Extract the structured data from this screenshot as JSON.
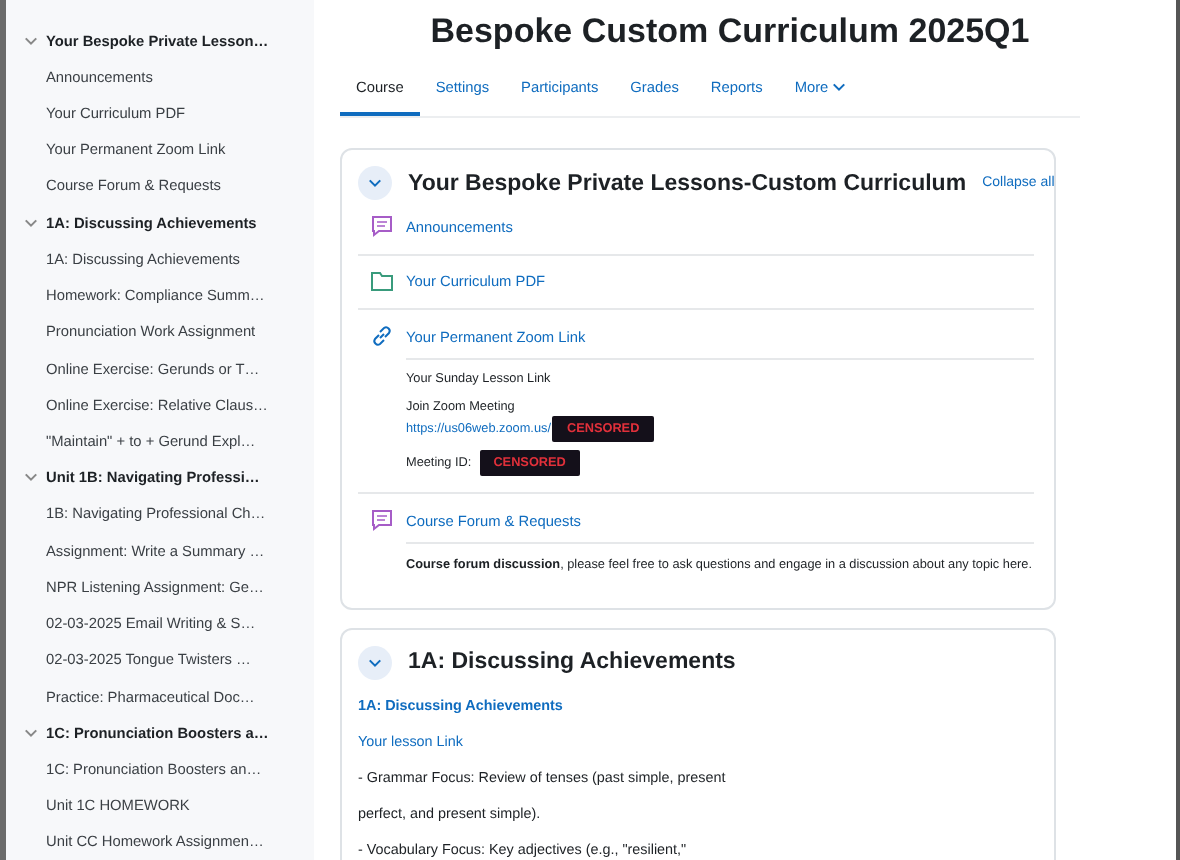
{
  "sidebar": {
    "sections": [
      {
        "title": "Your Bespoke Private Lesson…",
        "expanded": true,
        "items": [
          "Announcements",
          "Your Curriculum PDF",
          "Your Permanent Zoom Link",
          "Course Forum & Requests"
        ]
      },
      {
        "title": "1A: Discussing Achievements",
        "expanded": true,
        "items": [
          "1A: Discussing Achievements",
          "Homework: Compliance Summ…",
          "Pronunciation Work Assignment",
          "Online Exercise: Gerunds or T…",
          "Online Exercise: Relative Claus…",
          "\"Maintain\" + to + Gerund Expl…"
        ]
      },
      {
        "title": "Unit 1B: Navigating Professi…",
        "expanded": true,
        "items": [
          "1B: Navigating Professional Ch…",
          "Assignment: Write a Summary …",
          "NPR Listening Assignment: Ge…",
          "02-03-2025 Email Writing & S…",
          "02-03-2025 Tongue Twisters …",
          "Practice: Pharmaceutical Doc…"
        ]
      },
      {
        "title": "1C: Pronunciation Boosters a…",
        "expanded": true,
        "items": [
          "1C: Pronunciation Boosters an…",
          "Unit 1C HOMEWORK",
          "Unit CC Homework Assignmen…"
        ]
      }
    ]
  },
  "course_title": "Bespoke Custom Curriculum 2025Q1",
  "tabs": [
    {
      "label": "Course",
      "selected": true,
      "kind": "plain"
    },
    {
      "label": "Settings",
      "selected": false,
      "kind": "plain"
    },
    {
      "label": "Participants",
      "selected": false,
      "kind": "plain"
    },
    {
      "label": "Grades",
      "selected": false,
      "kind": "plain"
    },
    {
      "label": "Reports",
      "selected": false,
      "kind": "plain"
    },
    {
      "label": "More",
      "selected": false,
      "kind": "menu"
    }
  ],
  "section_1": {
    "title": "Your Bespoke Private Lessons-Custom Curriculum",
    "expanded": true,
    "collapse_all": "Collapse all",
    "activities": [
      {
        "kind": "forum",
        "name": "Announcements"
      },
      {
        "kind": "folder",
        "name": "Your Curriculum PDF"
      },
      {
        "kind": "url",
        "name": "Your Permanent Zoom Link",
        "lesson_label": "Your Sunday Lesson Link",
        "join_label": "Join Zoom Meeting",
        "join_url": "https://us06web.zoom.us/",
        "censored": "CENSORED",
        "meeting_id_label": "Meeting ID:",
        "meeting_id_censored": "CENSORED"
      },
      {
        "kind": "forum",
        "name": "Course Forum & Requests",
        "description": "**Course forum discussion**, please feel free to ask questions and engage in a discussion about any topic here."
      }
    ]
  },
  "section_2": {
    "title": "1A: Discussing Achievements",
    "expanded": true,
    "heading_link": "1A: Discussing Achievements",
    "lesson_link": "Your lesson Link",
    "lines": [
      "- Grammar Focus: Review of tenses (past simple, present",
      "perfect, and present simple).",
      "- Vocabulary Focus: Key adjectives (e.g., \"resilient,\""
    ]
  }
}
